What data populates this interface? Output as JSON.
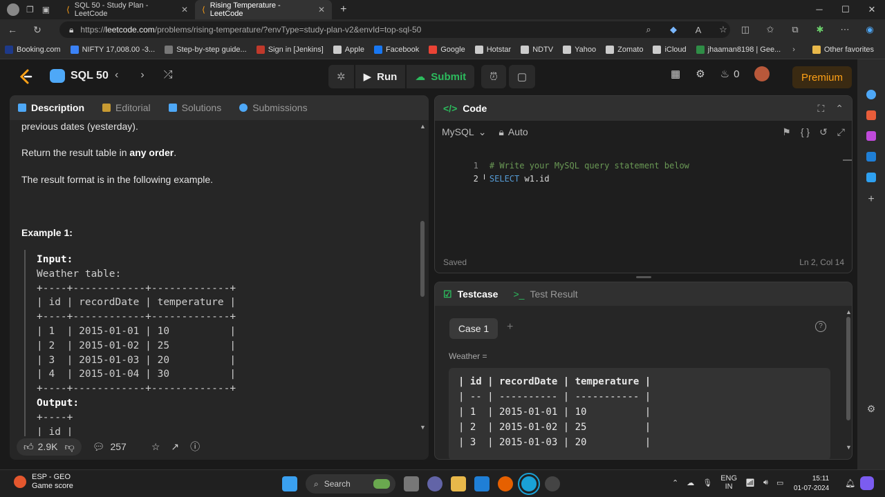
{
  "browser": {
    "tabs": [
      {
        "title": "SQL 50 - Study Plan - LeetCode",
        "active": false
      },
      {
        "title": "Rising Temperature - LeetCode",
        "active": true
      }
    ],
    "url_prefix": "https://",
    "url_host": "leetcode.com",
    "url_path": "/problems/rising-temperature/?envType=study-plan-v2&envId=top-sql-50",
    "bookmarks": [
      {
        "label": "Booking.com",
        "color": "#1e3a8a"
      },
      {
        "label": "NIFTY 17,008.00 -3...",
        "color": "#3b82f6"
      },
      {
        "label": "Step-by-step guide...",
        "color": "#777777"
      },
      {
        "label": "Sign in [Jenkins]",
        "color": "#c0392b"
      },
      {
        "label": "Apple",
        "color": "#cccccc"
      },
      {
        "label": "Facebook",
        "color": "#1877f2"
      },
      {
        "label": "Google",
        "color": "#ea4335"
      },
      {
        "label": "Hotstar",
        "color": "#cccccc"
      },
      {
        "label": "NDTV",
        "color": "#cccccc"
      },
      {
        "label": "Yahoo",
        "color": "#cccccc"
      },
      {
        "label": "Zomato",
        "color": "#cccccc"
      },
      {
        "label": "iCloud",
        "color": "#cccccc"
      },
      {
        "label": "jhaaman8198 | Gee...",
        "color": "#2f8d46"
      }
    ],
    "other_favorites": "Other favorites"
  },
  "header": {
    "plan_name": "SQL 50",
    "run_label": "Run",
    "submit_label": "Submit",
    "streak_count": "0",
    "premium_label": "Premium"
  },
  "left_panel": {
    "tabs": [
      "Description",
      "Editorial",
      "Solutions",
      "Submissions"
    ],
    "desc_line1": "previous dates (yesterday).",
    "return_prefix": "Return the result table in ",
    "return_bold": "any order",
    "return_suffix": ".",
    "format_line": "The result format is in the following example.",
    "example_title": "Example 1:",
    "example_lines": [
      {
        "text": "Input:",
        "bold": true
      },
      {
        "text": "Weather table:",
        "bold": false
      },
      {
        "text": "+----+------------+-------------+",
        "bold": false
      },
      {
        "text": "| id | recordDate | temperature |",
        "bold": false
      },
      {
        "text": "+----+------------+-------------+",
        "bold": false
      },
      {
        "text": "| 1  | 2015-01-01 | 10          |",
        "bold": false
      },
      {
        "text": "| 2  | 2015-01-02 | 25          |",
        "bold": false
      },
      {
        "text": "| 3  | 2015-01-03 | 20          |",
        "bold": false
      },
      {
        "text": "| 4  | 2015-01-04 | 30          |",
        "bold": false
      },
      {
        "text": "+----+------------+-------------+",
        "bold": false
      },
      {
        "text": "Output:",
        "bold": true
      },
      {
        "text": "+----+",
        "bold": false
      },
      {
        "text": "| id |",
        "bold": false
      }
    ],
    "likes": "2.9K",
    "comments": "257"
  },
  "code_panel": {
    "title": "Code",
    "language": "MySQL",
    "mode": "Auto",
    "lines": [
      {
        "num": "1",
        "text": "# Write your MySQL query statement below",
        "type": "comment"
      },
      {
        "num": "2",
        "keyword": "SELECT",
        "rest": " w1.id",
        "type": "code"
      }
    ],
    "status": "Saved",
    "cursor_pos": "Ln 2, Col 14"
  },
  "test_panel": {
    "tabs": [
      "Testcase",
      "Test Result"
    ],
    "case_label": "Case 1",
    "input_label": "Weather =",
    "table_lines": [
      "| id | recordDate | temperature |",
      "| -- | ---------- | ----------- |",
      "| 1  | 2015-01-01 | 10          |",
      "| 2  | 2015-01-02 | 25          |",
      "| 3  | 2015-01-03 | 20          |"
    ]
  },
  "taskbar": {
    "weather_title": "ESP - GEO",
    "weather_sub": "Game score",
    "search_label": "Search",
    "lang1": "ENG",
    "lang2": "IN",
    "time": "15:11",
    "date": "01-07-2024"
  }
}
